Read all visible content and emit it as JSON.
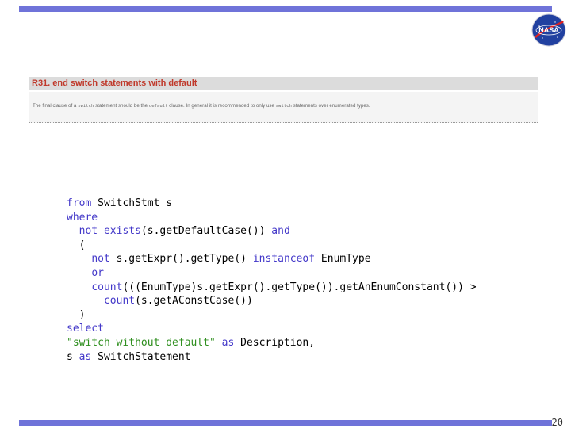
{
  "slide": {
    "rule": {
      "title": "R31. end switch statements with default",
      "body": {
        "t1": "The final clause of a",
        "c1": "switch",
        "t2": "statement should be the",
        "c2": "default",
        "t3": "clause. In general it is recommended to only use",
        "c3": "switch",
        "t4": "statements over enumerated types."
      }
    },
    "code": {
      "l1": {
        "kw1": "from",
        "t1": " SwitchStmt s"
      },
      "l2": {
        "kw1": "where"
      },
      "l3": {
        "ind": "  ",
        "kw1": "not",
        "kw2": " exists",
        "t1": "(s.getDefaultCase())",
        "kw3": " and"
      },
      "l4": {
        "t1": "  ("
      },
      "l5": {
        "ind": "    ",
        "kw1": "not",
        "t1": " s.getExpr().getType() ",
        "kw2": "instanceof",
        "t2": " EnumType"
      },
      "l6": {
        "ind": "    ",
        "kw1": "or"
      },
      "l7": {
        "ind": "    ",
        "kw1": "count",
        "t1": "(((EnumType)s.getExpr().getType()).getAnEnumConstant()) >"
      },
      "l8": {
        "ind": "      ",
        "kw1": "count",
        "t1": "(s.getAConstCase())"
      },
      "l9": {
        "t1": "  )"
      },
      "l10": {
        "kw1": "select"
      },
      "l11": {
        "str1": "\"switch without default\"",
        "kw1": " as",
        "t1": " Description,"
      },
      "l12": {
        "t1": "s ",
        "kw1": "as",
        "t2": " SwitchStatement"
      }
    },
    "page_number": "20"
  },
  "colors": {
    "accent_bar": "#6f73d9",
    "keyword": "#4338c9",
    "string": "#2f8f1f",
    "rule_title": "#c0392b"
  },
  "icons": {
    "logo": "nasa-meatball-logo"
  }
}
